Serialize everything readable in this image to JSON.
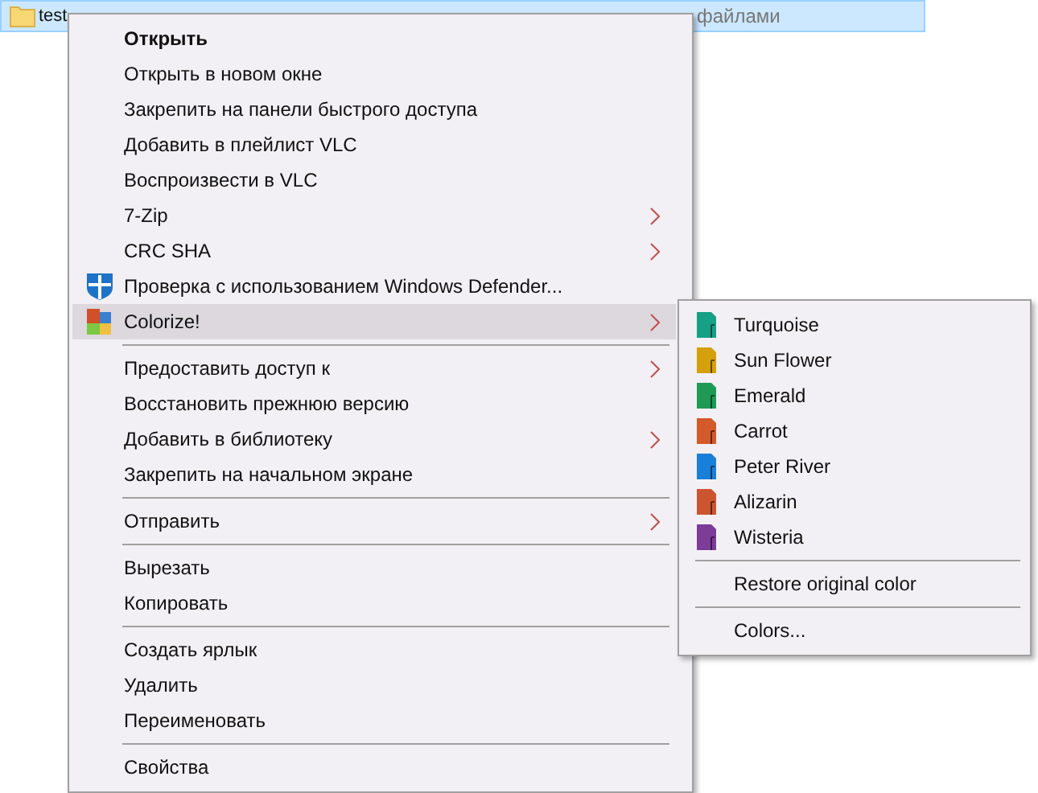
{
  "file_row": {
    "name": "test",
    "type": "файлами"
  },
  "context_menu": {
    "items": [
      {
        "kind": "item",
        "label": "Открыть",
        "bold": true,
        "submenu": false,
        "selected": false
      },
      {
        "kind": "item",
        "label": "Открыть в новом окне",
        "bold": false,
        "submenu": false,
        "selected": false
      },
      {
        "kind": "item",
        "label": "Закрепить на панели быстрого доступа",
        "bold": false,
        "submenu": false,
        "selected": false
      },
      {
        "kind": "item",
        "label": "Добавить в плейлист VLC",
        "bold": false,
        "submenu": false,
        "selected": false
      },
      {
        "kind": "item",
        "label": "Воспроизвести в VLC",
        "bold": false,
        "submenu": false,
        "selected": false
      },
      {
        "kind": "item",
        "label": "7-Zip",
        "bold": false,
        "submenu": true,
        "selected": false
      },
      {
        "kind": "item",
        "label": "CRC SHA",
        "bold": false,
        "submenu": true,
        "selected": false
      },
      {
        "kind": "shield",
        "label": "Проверка с использованием Windows Defender...",
        "bold": false,
        "submenu": false,
        "selected": false
      },
      {
        "kind": "palette",
        "label": "Colorize!",
        "bold": false,
        "submenu": true,
        "selected": true
      },
      {
        "kind": "separator"
      },
      {
        "kind": "item",
        "label": "Предоставить доступ к",
        "bold": false,
        "submenu": true,
        "selected": false
      },
      {
        "kind": "item",
        "label": "Восстановить прежнюю версию",
        "bold": false,
        "submenu": false,
        "selected": false
      },
      {
        "kind": "item",
        "label": "Добавить в библиотеку",
        "bold": false,
        "submenu": true,
        "selected": false
      },
      {
        "kind": "item",
        "label": "Закрепить на начальном экране",
        "bold": false,
        "submenu": false,
        "selected": false
      },
      {
        "kind": "separator"
      },
      {
        "kind": "item",
        "label": "Отправить",
        "bold": false,
        "submenu": true,
        "selected": false
      },
      {
        "kind": "separator"
      },
      {
        "kind": "item",
        "label": "Вырезать",
        "bold": false,
        "submenu": false,
        "selected": false
      },
      {
        "kind": "item",
        "label": "Копировать",
        "bold": false,
        "submenu": false,
        "selected": false
      },
      {
        "kind": "separator"
      },
      {
        "kind": "item",
        "label": "Создать ярлык",
        "bold": false,
        "submenu": false,
        "selected": false
      },
      {
        "kind": "item",
        "label": "Удалить",
        "bold": false,
        "submenu": false,
        "selected": false
      },
      {
        "kind": "item",
        "label": "Переименовать",
        "bold": false,
        "submenu": false,
        "selected": false
      },
      {
        "kind": "separator"
      },
      {
        "kind": "item",
        "label": "Свойства",
        "bold": false,
        "submenu": false,
        "selected": false
      }
    ]
  },
  "submenu": {
    "items": [
      {
        "kind": "color",
        "label": "Turquoise",
        "color": "#16a085"
      },
      {
        "kind": "color",
        "label": "Sun Flower",
        "color": "#d4a00c"
      },
      {
        "kind": "color",
        "label": "Emerald",
        "color": "#1e9a55"
      },
      {
        "kind": "color",
        "label": "Carrot",
        "color": "#d35a2a"
      },
      {
        "kind": "color",
        "label": "Peter River",
        "color": "#1a7fd8"
      },
      {
        "kind": "color",
        "label": "Alizarin",
        "color": "#cc5530"
      },
      {
        "kind": "color",
        "label": "Wisteria",
        "color": "#7d3c98"
      },
      {
        "kind": "separator"
      },
      {
        "kind": "item",
        "label": "Restore original color"
      },
      {
        "kind": "separator"
      },
      {
        "kind": "item",
        "label": "Colors..."
      }
    ]
  }
}
